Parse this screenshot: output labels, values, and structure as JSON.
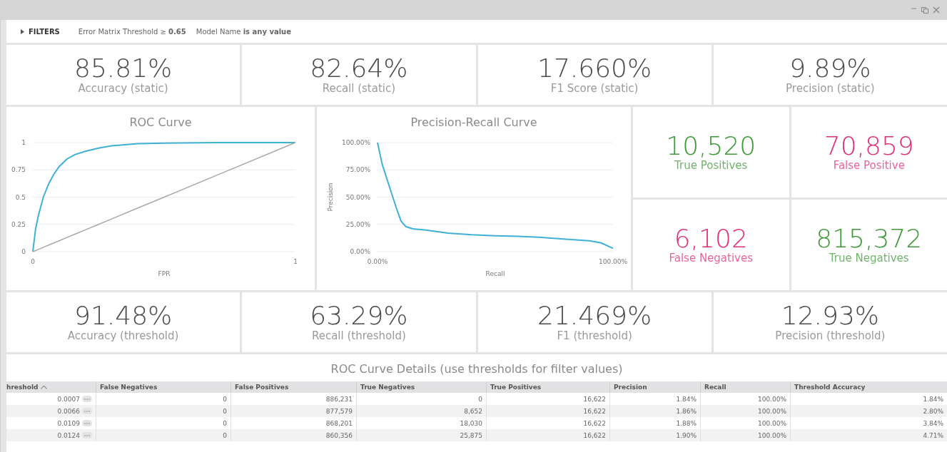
{
  "filters": {
    "label": "FILTERS",
    "expanded": false,
    "items": [
      "Error Matrix Threshold ≥ **0.65**",
      "Model Name **is any value**"
    ]
  },
  "kpis_static": [
    {
      "value": "85.81%",
      "label": "Accuracy (static)"
    },
    {
      "value": "82.64%",
      "label": "Recall (static)"
    },
    {
      "value": "17.660%",
      "label": "F1 Score (static)"
    },
    {
      "value": "9.89%",
      "label": "Precision (static)"
    }
  ],
  "roc_chart": {
    "chart_data": {
      "type": "line",
      "title": "ROC Curve",
      "xlabel": "FPR",
      "xlim": [
        0,
        1
      ],
      "ylim": [
        0,
        1
      ],
      "xticks": [
        0,
        1
      ],
      "yticks": [
        0,
        0.25,
        0.5,
        0.75,
        1
      ],
      "x": [
        0,
        0.01,
        0.02,
        0.04,
        0.06,
        0.08,
        0.1,
        0.13,
        0.16,
        0.2,
        0.25,
        0.3,
        0.4,
        0.5,
        0.7,
        1
      ],
      "grid": true,
      "series": [
        {
          "color": "#3eb0d5",
          "values": [
            0,
            0.2,
            0.32,
            0.5,
            0.62,
            0.71,
            0.78,
            0.85,
            0.89,
            0.92,
            0.95,
            0.97,
            0.99,
            0.995,
            1,
            1
          ]
        },
        {
          "color": "#a8a8a8",
          "values": [
            0,
            0.01,
            0.02,
            0.04,
            0.06,
            0.08,
            0.1,
            0.13,
            0.16,
            0.2,
            0.25,
            0.3,
            0.4,
            0.5,
            0.7,
            1
          ]
        }
      ]
    }
  },
  "pr_chart": {
    "chart_data": {
      "type": "line",
      "title": "Precision-Recall Curve",
      "xlabel": "Recall",
      "ylabel": "Precision",
      "xlim": [
        0,
        100
      ],
      "ylim": [
        0,
        100
      ],
      "xticks": [
        {
          "value": 0,
          "label": "0.00%"
        },
        {
          "value": 100,
          "label": "100.00%"
        }
      ],
      "yticks": [
        {
          "value": 0,
          "label": "0.00%"
        },
        {
          "value": 25,
          "label": "25.00%"
        },
        {
          "value": 50,
          "label": "50.00%"
        },
        {
          "value": 75,
          "label": "75.00%"
        },
        {
          "value": 100,
          "label": "100.00%"
        }
      ],
      "x": [
        0,
        2,
        5,
        8,
        10,
        12,
        15,
        20,
        30,
        40,
        50,
        60,
        70,
        80,
        90,
        95,
        100
      ],
      "grid": true,
      "series": [
        {
          "color": "#3eb0d5",
          "values": [
            100,
            80,
            60,
            40,
            28,
            23,
            21,
            20,
            17,
            15.5,
            14.5,
            14,
            13,
            11.5,
            10,
            8,
            3
          ]
        }
      ]
    }
  },
  "confusion": [
    {
      "value": "10,520",
      "label": "True Positives",
      "color": "#3f9a3a"
    },
    {
      "value": "70,859",
      "label": "False Positive",
      "color": "#e0307a"
    },
    {
      "value": "6,102",
      "label": "False Negatives",
      "color": "#e0307a"
    },
    {
      "value": "815,372",
      "label": "True Negatives",
      "color": "#3f9a3a"
    }
  ],
  "kpis_threshold": [
    {
      "value": "91.48%",
      "label": "Accuracy (threshold)"
    },
    {
      "value": "63.29%",
      "label": "Recall (threshold)"
    },
    {
      "value": "21.469%",
      "label": "F1 (threshold)"
    },
    {
      "value": "12.93%",
      "label": "Precision (threshold)"
    }
  ],
  "table": {
    "title": "ROC Curve Details (use thresholds for filter values)",
    "columns": [
      {
        "label": "hreshold",
        "sorted": true
      },
      {
        "label": "False Negatives",
        "sorted": false
      },
      {
        "label": "False Positives",
        "sorted": false
      },
      {
        "label": "True Negatives",
        "sorted": false
      },
      {
        "label": "True Positives",
        "sorted": false
      },
      {
        "label": "Precision",
        "sorted": false
      },
      {
        "label": "Recall",
        "sorted": false
      },
      {
        "label": "Threshold Accuracy",
        "sorted": false
      }
    ],
    "rows": [
      [
        "0.0007",
        "0",
        "886,231",
        "0",
        "16,622",
        "1.84%",
        "100.00%",
        "1.84%"
      ],
      [
        "0.0066",
        "0",
        "877,579",
        "8,652",
        "16,622",
        "1.86%",
        "100.00%",
        "2.80%"
      ],
      [
        "0.0109",
        "0",
        "868,201",
        "18,030",
        "16,622",
        "1.88%",
        "100.00%",
        "3.84%"
      ],
      [
        "0.0124",
        "0",
        "860,356",
        "25,875",
        "16,622",
        "1.90%",
        "100.00%",
        "4.71%"
      ]
    ]
  }
}
